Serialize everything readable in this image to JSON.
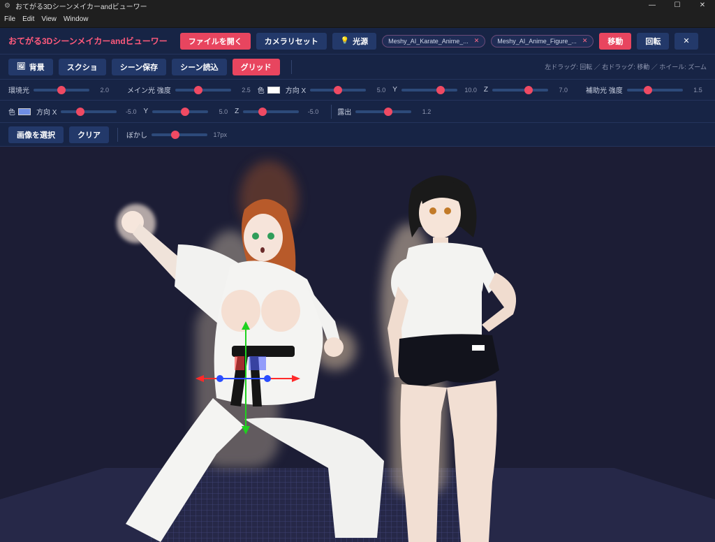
{
  "window": {
    "title": "おてがる3Dシーンメイカーandビューワー",
    "minimize": "—",
    "maximize": "☐",
    "close": "✕"
  },
  "menu": [
    "File",
    "Edit",
    "View",
    "Window"
  ],
  "toolbar1": {
    "app_title": "おてがる3Dシーンメイカーandビューワー",
    "open_file": "ファイルを開く",
    "camera_reset": "カメラリセット",
    "light": "光源",
    "files": [
      "Meshy_AI_Karate_Anime_...",
      "Meshy_AI_Anime_Figure_..."
    ],
    "move": "移動",
    "rotate": "回転",
    "close": "✕"
  },
  "toolbar2": {
    "background": "背景",
    "screenshot": "スクショ",
    "scene_save": "シーン保存",
    "scene_load": "シーン読込",
    "grid": "グリッド",
    "hint": "左ドラッグ: 回転 ／ 右ドラッグ: 移動 ／ ホイール: ズーム"
  },
  "lighting": {
    "ambient": {
      "label": "環境光",
      "value": "2.0",
      "level": 0.5
    },
    "main_intensity": {
      "label": "メイン光 強度",
      "value": "2.5",
      "level": 0.42
    },
    "main_color_label": "色",
    "main_color": "#ffffff",
    "main_dir_x": {
      "label": "方向 X",
      "value": "5.0",
      "level": 0.5
    },
    "main_dir_y": {
      "label": "Y",
      "value": "10.0",
      "level": 0.7
    },
    "main_dir_z": {
      "label": "Z",
      "value": "7.0",
      "level": 0.65
    },
    "fill_intensity": {
      "label": "補助光 強度",
      "value": "1.5",
      "level": 0.38
    },
    "fill_color_label": "色",
    "fill_color": "#6f8ee6",
    "fill_dir_x": {
      "label": "方向 X",
      "value": "-5.0",
      "level": 0.35
    },
    "fill_dir_y": {
      "label": "Y",
      "value": "5.0",
      "level": 0.58
    },
    "fill_dir_z": {
      "label": "Z",
      "value": "-5.0",
      "level": 0.35
    },
    "exposure": {
      "label": "露出",
      "value": "1.2",
      "level": 0.58
    }
  },
  "background_image": {
    "select": "画像を選択",
    "clear": "クリア",
    "blur_label": "ぼかし",
    "blur_value": "17px",
    "blur_level": 0.43
  },
  "colors": {
    "accent": "#e8455f",
    "toolbar_bg": "#172445",
    "viewport_bg": "#1c1d35"
  }
}
